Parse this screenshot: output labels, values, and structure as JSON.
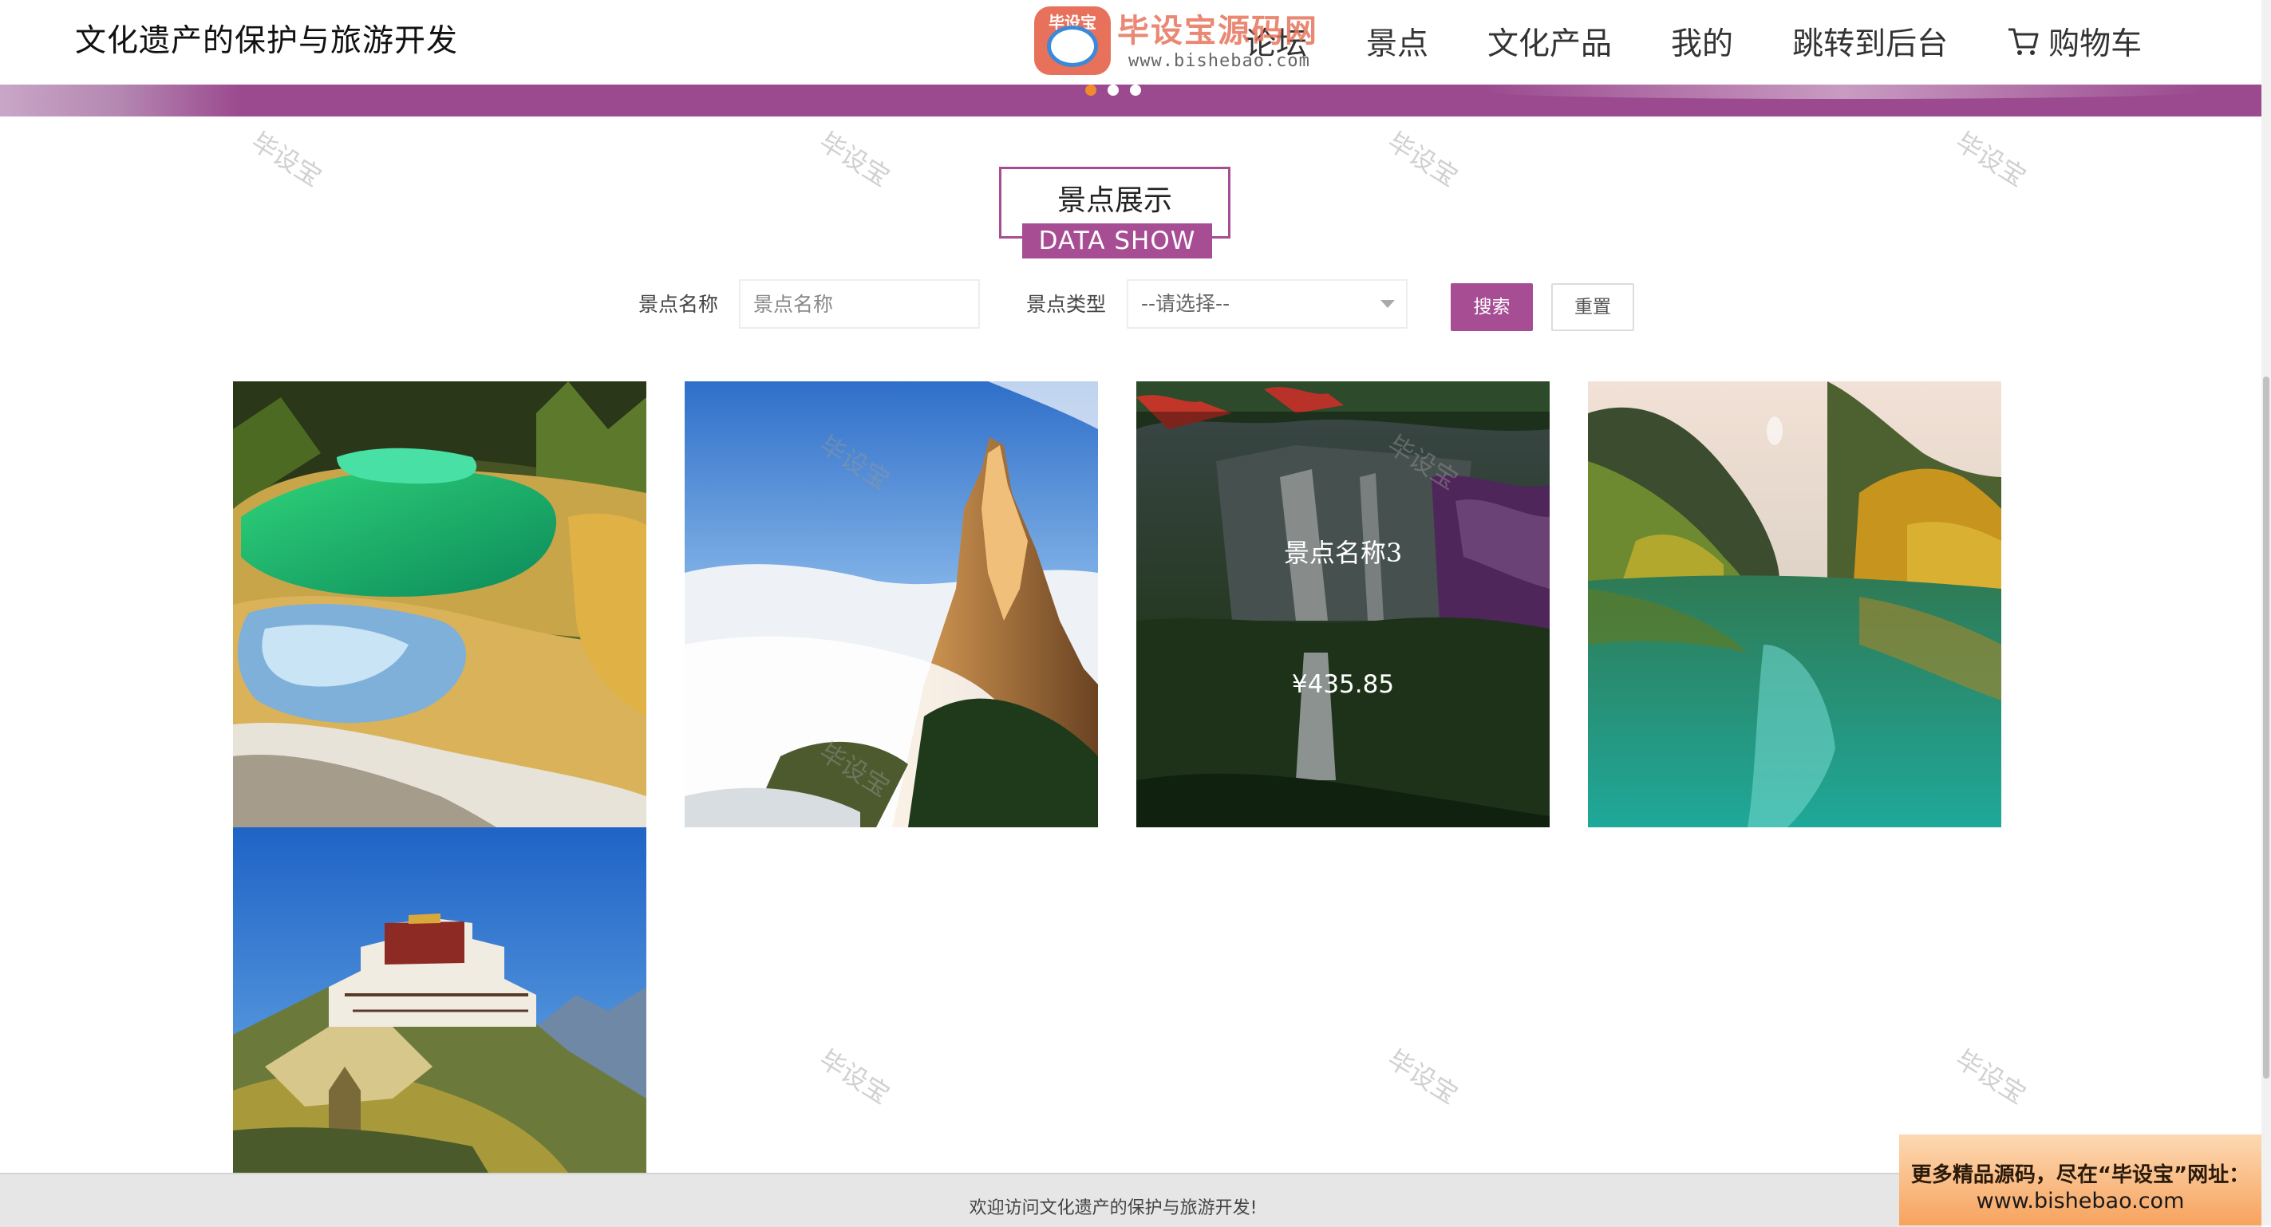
{
  "header": {
    "site_title": "文化遗产的保护与旅游开发",
    "nav": {
      "forum": "论坛",
      "scenic": "景点",
      "culture_products": "文化产品",
      "mine": "我的",
      "admin": "跳转到后台",
      "cart": "购物车"
    }
  },
  "logo_watermark": {
    "badge_text": "毕设宝",
    "name": "毕设宝源码网",
    "url": "www.bishebao.com"
  },
  "section": {
    "title_cn": "景点展示",
    "title_en": "DATA SHOW"
  },
  "search": {
    "name_label": "景点名称",
    "name_placeholder": "景点名称",
    "type_label": "景点类型",
    "type_selected": "--请选择--",
    "search_button": "搜索",
    "reset_button": "重置"
  },
  "cards": [
    {
      "scene": "colorful-pools"
    },
    {
      "scene": "misty-mountain-peak"
    },
    {
      "scene": "waterfall",
      "name": "景点名称3",
      "price": "¥435.85"
    },
    {
      "scene": "mountain-lake"
    },
    {
      "scene": "potala-palace"
    }
  ],
  "watermark_text": "毕设宝",
  "footer": {
    "text": "欢迎访问文化遗产的保护与旅游开发!"
  },
  "promo": {
    "line1": "更多精品源码，尽在“毕设宝”网址：",
    "line2": "www.bishebao.com"
  },
  "colors": {
    "accent": "#a64d94",
    "banner": "#9b4a8f",
    "dot_active": "#f08b2e",
    "footer_bg": "#e6e6e6"
  }
}
